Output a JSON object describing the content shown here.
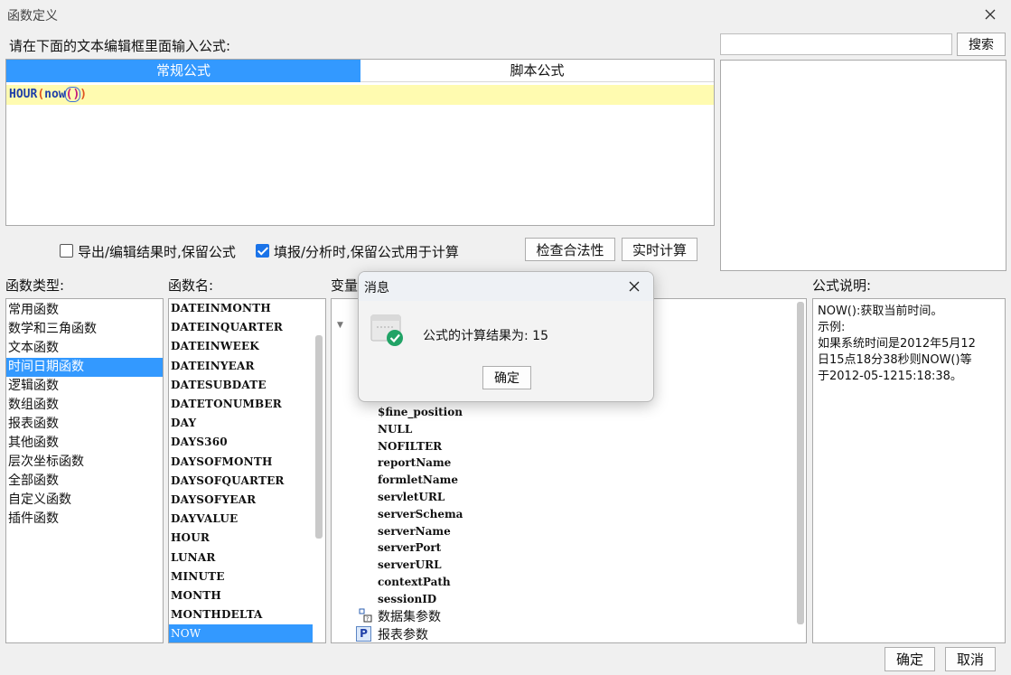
{
  "window": {
    "title": "函数定义"
  },
  "editor": {
    "prompt": "请在下面的文本编辑框里面输入公式:",
    "tabs": [
      {
        "label": "常规公式",
        "active": true
      },
      {
        "label": "脚本公式",
        "active": false
      }
    ],
    "formula": {
      "fn": "HOUR",
      "open": "(",
      "inner": "now",
      "inner_parens": "()",
      "close": ")"
    }
  },
  "search": {
    "value": "",
    "button_label": "搜索"
  },
  "options": {
    "export_keep": {
      "label": "导出/编辑结果时,保留公式",
      "checked": false
    },
    "fill_keep": {
      "label": "填报/分析时,保留公式用于计算",
      "checked": true
    },
    "check_button": "检查合法性",
    "realtime_button": "实时计算"
  },
  "func_types": {
    "label": "函数类型:",
    "items": [
      "常用函数",
      "数学和三角函数",
      "文本函数",
      "时间日期函数",
      "逻辑函数",
      "数组函数",
      "报表函数",
      "其他函数",
      "层次坐标函数",
      "全部函数",
      "自定义函数",
      "插件函数"
    ],
    "selected": "时间日期函数"
  },
  "func_names": {
    "label": "函数名:",
    "items": [
      "DATEINMONTH",
      "DATEINQUARTER",
      "DATEINWEEK",
      "DATEINYEAR",
      "DATESUBDATE",
      "DATETONUMBER",
      "DAY",
      "DAYS360",
      "DAYSOFMONTH",
      "DAYSOFQUARTER",
      "DAYSOFYEAR",
      "DAYVALUE",
      "HOUR",
      "LUNAR",
      "MINUTE",
      "MONTH",
      "MONTHDELTA",
      "NOW"
    ],
    "selected": "NOW"
  },
  "variables": {
    "label": "变量",
    "items": [
      "$fine_position",
      "NULL",
      "NOFILTER",
      "reportName",
      "formletName",
      "servletURL",
      "serverSchema",
      "serverName",
      "serverPort",
      "serverURL",
      "contextPath",
      "sessionID"
    ],
    "groups": [
      "数据集参数",
      "报表参数"
    ]
  },
  "description": {
    "label": "公式说明:",
    "lines": [
      "NOW():获取当前时间。",
      "示例:",
      "如果系统时间是2012年5月12",
      "日15点18分38秒则NOW()等",
      "于2012-05-1215:18:38。"
    ]
  },
  "footer": {
    "ok_label": "确定",
    "cancel_label": "取消"
  },
  "message_dialog": {
    "title": "消息",
    "text": "公式的计算结果为: 15",
    "ok_label": "确定"
  },
  "colors": {
    "accent": "#3399ff",
    "selection": "#3399ff",
    "formula_line": "#fffbb0",
    "success": "#21a366"
  }
}
